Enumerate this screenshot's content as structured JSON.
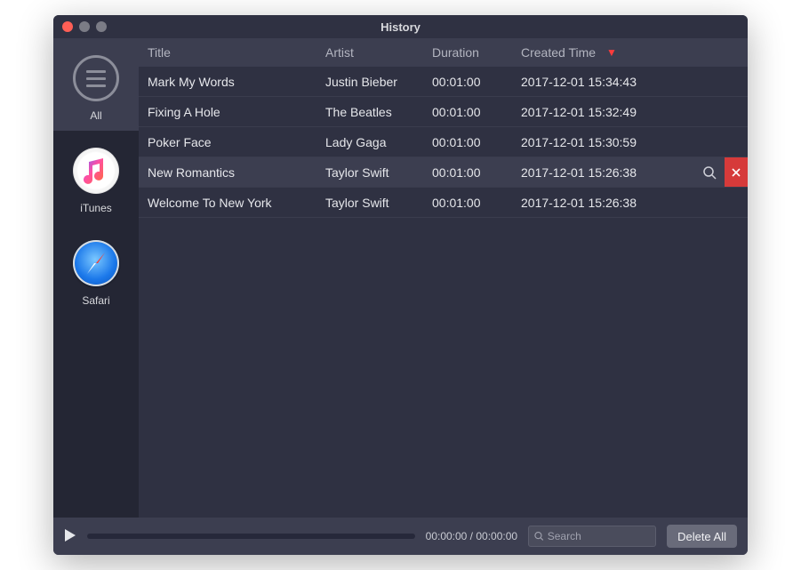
{
  "window": {
    "title": "History"
  },
  "sidebar": {
    "items": [
      {
        "label": "All",
        "icon": "hamburger-icon",
        "active": true
      },
      {
        "label": "iTunes",
        "icon": "itunes-icon",
        "active": false
      },
      {
        "label": "Safari",
        "icon": "safari-icon",
        "active": false
      }
    ]
  },
  "table": {
    "columns": {
      "title": "Title",
      "artist": "Artist",
      "duration": "Duration",
      "created": "Created Time"
    },
    "sort": {
      "column": "created",
      "direction": "desc",
      "glyph": "▼"
    },
    "rows": [
      {
        "title": "Mark My Words",
        "artist": "Justin Bieber",
        "duration": "00:01:00",
        "created": "2017-12-01 15:34:43",
        "hovered": false
      },
      {
        "title": "Fixing A Hole",
        "artist": "The Beatles",
        "duration": "00:01:00",
        "created": "2017-12-01 15:32:49",
        "hovered": false
      },
      {
        "title": "Poker Face",
        "artist": "Lady Gaga",
        "duration": "00:01:00",
        "created": "2017-12-01 15:30:59",
        "hovered": false
      },
      {
        "title": "New Romantics",
        "artist": "Taylor Swift",
        "duration": "00:01:00",
        "created": "2017-12-01 15:26:38",
        "hovered": true
      },
      {
        "title": "Welcome To New York",
        "artist": "Taylor Swift",
        "duration": "00:01:00",
        "created": "2017-12-01 15:26:38",
        "hovered": false
      }
    ]
  },
  "footer": {
    "time_elapsed": "00:00:00",
    "time_total": "00:00:00",
    "time_display": "00:00:00 / 00:00:00",
    "search_placeholder": "Search",
    "search_value": "",
    "delete_all_label": "Delete All"
  }
}
